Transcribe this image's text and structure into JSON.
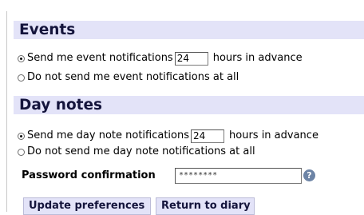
{
  "events": {
    "heading": "Events",
    "send_before": "Send me event notifications",
    "hours_value": "24",
    "send_after": "hours in advance",
    "none_label": "Do not send me event notifications at all"
  },
  "day_notes": {
    "heading": "Day notes",
    "send_before": "Send me day note notifications",
    "hours_value": "24",
    "send_after": "hours in advance",
    "none_label": "Do not send me day note notifications at all"
  },
  "password": {
    "label": "Password confirmation",
    "masked_value": "********",
    "help_icon": "question-mark-icon",
    "help_glyph": "?"
  },
  "buttons": {
    "update": "Update preferences",
    "return": "Return to diary"
  }
}
